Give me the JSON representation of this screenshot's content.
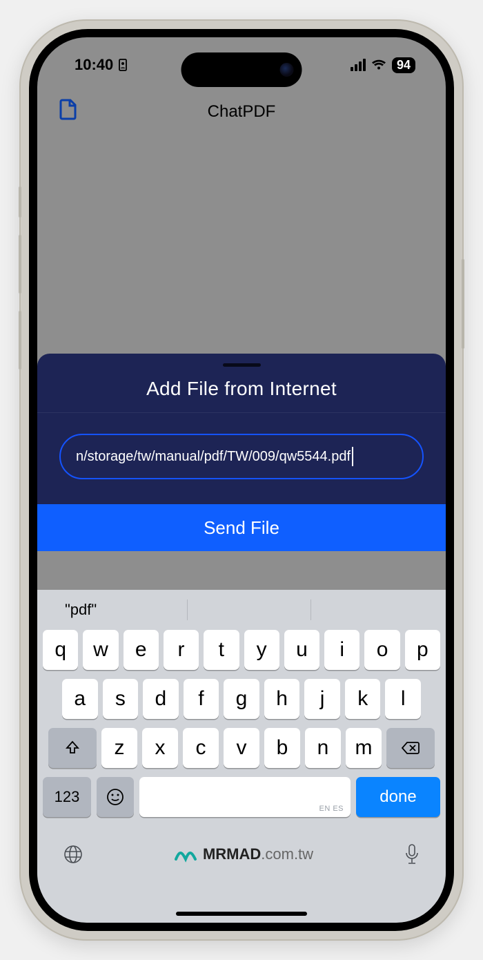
{
  "status": {
    "time": "10:40",
    "battery": "94"
  },
  "nav": {
    "title": "ChatPDF"
  },
  "sheet": {
    "title": "Add File from Internet",
    "url_value": "n/storage/tw/manual/pdf/TW/009/qw5544.pdf",
    "send_label": "Send File"
  },
  "keyboard": {
    "suggestion": "\"pdf\"",
    "row1": [
      "q",
      "w",
      "e",
      "r",
      "t",
      "y",
      "u",
      "i",
      "o",
      "p"
    ],
    "row2": [
      "a",
      "s",
      "d",
      "f",
      "g",
      "h",
      "j",
      "k",
      "l"
    ],
    "row3": [
      "z",
      "x",
      "c",
      "v",
      "b",
      "n",
      "m"
    ],
    "numkey": "123",
    "space_lang": "EN ES",
    "done": "done"
  },
  "brand": {
    "name": "MRMAD",
    "suffix": ".com.tw"
  }
}
